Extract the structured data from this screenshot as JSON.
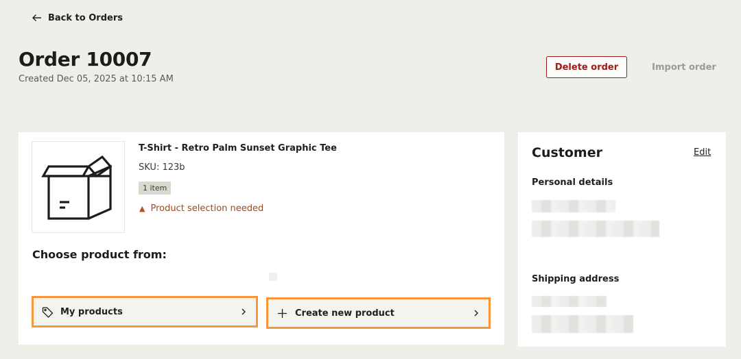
{
  "nav": {
    "back_label": "Back to Orders"
  },
  "header": {
    "title": "Order 10007",
    "created": "Created Dec 05, 2025 at 10:15 AM",
    "delete_label": "Delete order",
    "import_label": "Import order"
  },
  "product": {
    "name": "T-Shirt - Retro Palm Sunset Graphic Tee",
    "sku": "SKU: 123b",
    "quantity_badge": "1 item",
    "warning": "Product selection needed",
    "image_icon": "box-icon"
  },
  "choose": {
    "heading": "Choose product from:",
    "options": [
      {
        "label": "My products",
        "icon": "tag-icon"
      },
      {
        "label": "Create new product",
        "icon": "plus-icon"
      }
    ]
  },
  "customer": {
    "title": "Customer",
    "edit_label": "Edit",
    "personal_label": "Personal details",
    "shipping_label": "Shipping address"
  },
  "colors": {
    "background": "#efefea",
    "danger": "#a01818",
    "warning": "#a0481a",
    "highlight": "#f7963a",
    "muted": "#9b9b93"
  }
}
